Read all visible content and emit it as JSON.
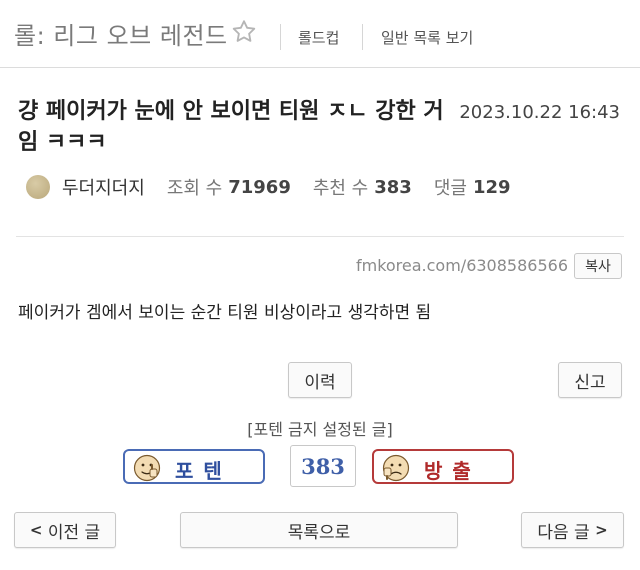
{
  "header": {
    "board_title": "롤: 리그 오브 레전드",
    "nav": {
      "cup": "롤드컵",
      "general_list": "일반 목록 보기"
    }
  },
  "post": {
    "title": "걍 페이커가 눈에 안 보이면 티원 ㅈㄴ 강한 거임 ㅋㅋㅋ",
    "date": "2023.10.22 16:43",
    "author": "두더지더지",
    "stats": {
      "views_label": "조회 수",
      "views": "71969",
      "likes_label": "추천 수",
      "likes": "383",
      "comments_label": "댓글",
      "comments": "129"
    },
    "short_url": "fmkorea.com/6308586566",
    "copy_label": "복사",
    "body": "페이커가 겜에서 보이는 순간 티원 비상이라고 생각하면 됨"
  },
  "actions": {
    "history": "이력",
    "report": "신고",
    "notice": "[포텐 금지 설정된 글]",
    "vote_up": "포텐",
    "vote_count": "383",
    "vote_down": "방출"
  },
  "footer_nav": {
    "prev_chev": "<",
    "prev": "이전 글",
    "list": "목록으로",
    "next": "다음 글",
    "next_chev": ">"
  },
  "colors": {
    "vote_up_border": "#4a6bb5",
    "vote_down_border": "#b53a3a",
    "vote_count_text": "#3f5fa8"
  },
  "icons": {
    "star": "star-outline-icon",
    "thumbs_up_face": "thumbs-up-face-icon",
    "thumbs_down_face": "thumbs-down-face-icon"
  }
}
